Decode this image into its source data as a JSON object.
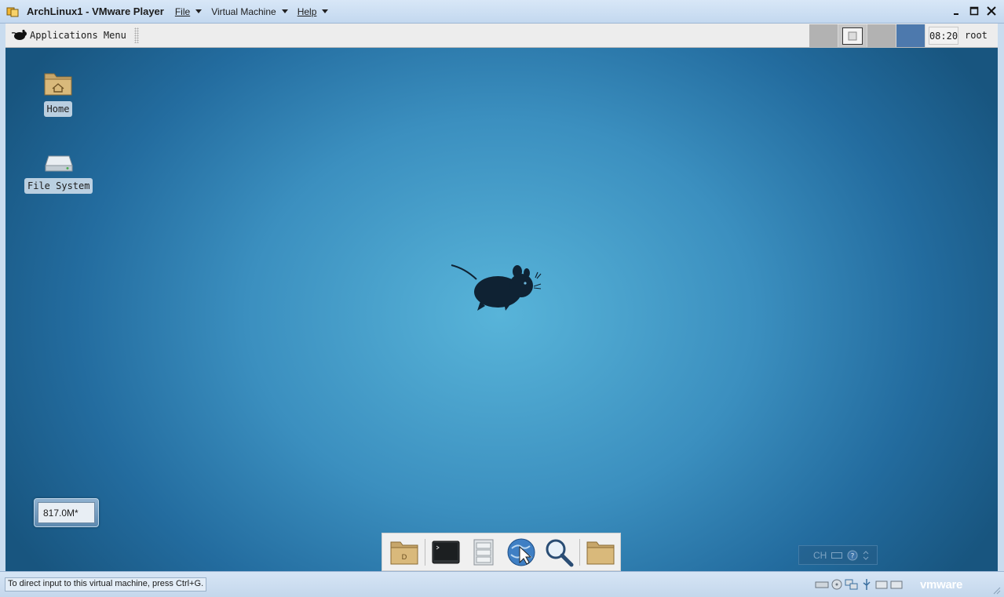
{
  "window": {
    "title": "ArchLinux1 - VMware Player",
    "menus": [
      {
        "label": "File"
      },
      {
        "label": "Virtual Machine"
      },
      {
        "label": "Help"
      }
    ]
  },
  "panel": {
    "apps_menu_label": "Applications Menu",
    "clock": "08:20",
    "user": "root",
    "workspace_active_color": "#4d79ad"
  },
  "desktop": {
    "icons": [
      {
        "label": "Home",
        "icon": "home-folder-icon"
      },
      {
        "label": "File System",
        "icon": "hard-drive-icon"
      }
    ],
    "memory_widget": "817.0M*",
    "dock": [
      {
        "icon": "documents-folder-icon"
      },
      {
        "icon": "terminal-icon"
      },
      {
        "icon": "file-cabinet-icon"
      },
      {
        "icon": "web-browser-icon"
      },
      {
        "icon": "search-icon"
      },
      {
        "icon": "folder-icon"
      }
    ],
    "keyboard_layout": "CH"
  },
  "statusbar": {
    "hint": "To direct input to this virtual machine, press Ctrl+G.",
    "brand": "vmware"
  }
}
